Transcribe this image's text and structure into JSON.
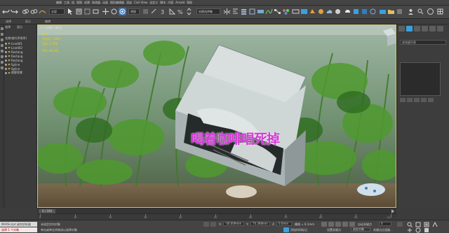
{
  "menubar": {
    "items": [
      "编辑",
      "工具",
      "组",
      "视图",
      "创建",
      "修改器",
      "动画",
      "图形编辑器",
      "渲染",
      "Civil View",
      "自定义",
      "脚本",
      "内容",
      "Arnold",
      "帮助"
    ]
  },
  "toolbar": {
    "selection_filter": "全部",
    "view_dropdown": "视图",
    "named_selection": "创建选择集"
  },
  "ribbon": {
    "items": [
      "选择",
      "显示",
      "编辑"
    ]
  },
  "explorer": {
    "tab_select": "选择",
    "tab_display": "显示",
    "rows": [
      {
        "label": "名称(按升序排序)"
      },
      {
        "label": "Line001"
      },
      {
        "label": "Line002"
      },
      {
        "label": "Rectang"
      },
      {
        "label": "Rectang"
      },
      {
        "label": "Rectang"
      },
      {
        "label": "Spline"
      },
      {
        "label": "Spline"
      },
      {
        "label": "视野背景"
      }
    ]
  },
  "viewport": {
    "label": "[+] [透视] [真实]",
    "stats": [
      "总计",
      "多边形: 1,840",
      "顶点: 1,708",
      "FPS: 98.481"
    ],
    "overlay_text": "喝着咖啡唱死掉"
  },
  "cmdpanel": {
    "rollout": "修改器列表",
    "object_name": "修改器列表"
  },
  "timeline": {
    "frame_display": "0 / 100",
    "ticks": [
      "0",
      "10",
      "20",
      "30",
      "40",
      "50",
      "60",
      "70",
      "80",
      "90",
      "100"
    ]
  },
  "statusbar": {
    "maxscript_label": "MAXScript 迷你侦听器",
    "maxscript_error": "选择 1 个对象",
    "prompt": "未选定任何对象",
    "prompt2": "单击或单击并拖动以选择对象",
    "x_label": "X:",
    "x_value": "-50.009mm",
    "y_label": "Y:",
    "y_value": "74.368mm",
    "z_label": "Z:",
    "z_value": "0.0mm",
    "grid": "栅格 = 0.1mm",
    "add_time_tag": "添加时间标记",
    "auto_key": "自动关键点",
    "set_key": "设置关键点",
    "selected": "选定对象",
    "key_filter": "关键点过滤器...",
    "frame": "0"
  },
  "colors": {
    "accent": "#3aa0e0",
    "overlay_text": "#d23cd6",
    "stats_text": "#f0d000",
    "viewport_border": "#c6c67a"
  }
}
